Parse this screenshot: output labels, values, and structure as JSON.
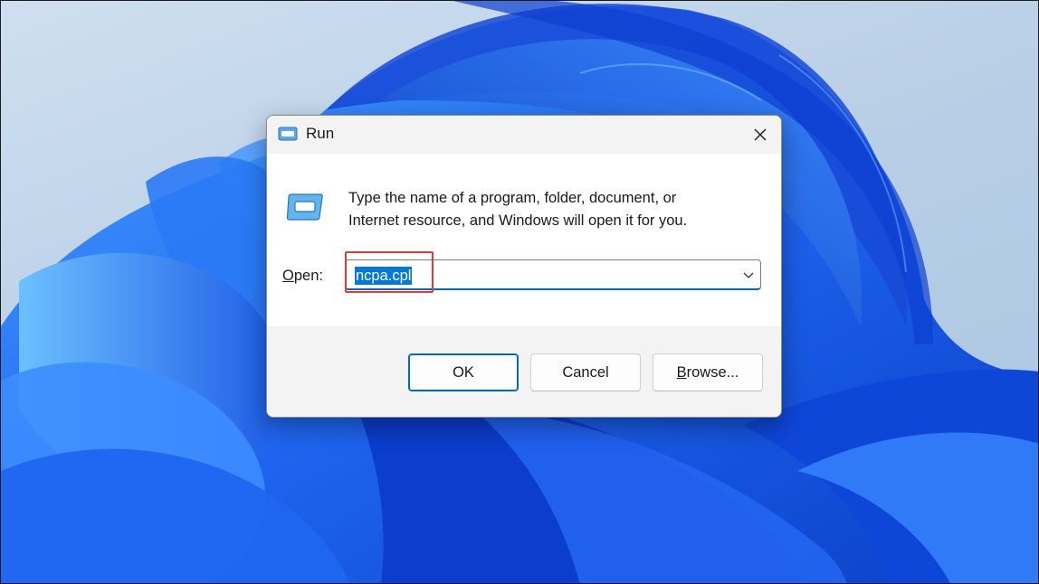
{
  "desktop": {
    "wallpaper_icon": "windows-bloom-wallpaper"
  },
  "dialog": {
    "title": "Run",
    "close_icon": "close-icon",
    "description_line1": "Type the name of a program, folder, document, or",
    "description_line2": "Internet resource, and Windows will open it for you.",
    "open_label_mnemonic": "O",
    "open_label_rest": "pen:",
    "input_value": "ncpa.cpl",
    "buttons": {
      "ok": "OK",
      "cancel": "Cancel",
      "browse_mnemonic": "B",
      "browse_rest": "rowse..."
    }
  },
  "colors": {
    "accent": "#0078d4",
    "highlight_border": "#e03a3a",
    "wallpaper_blue": "#1a5fe8"
  }
}
